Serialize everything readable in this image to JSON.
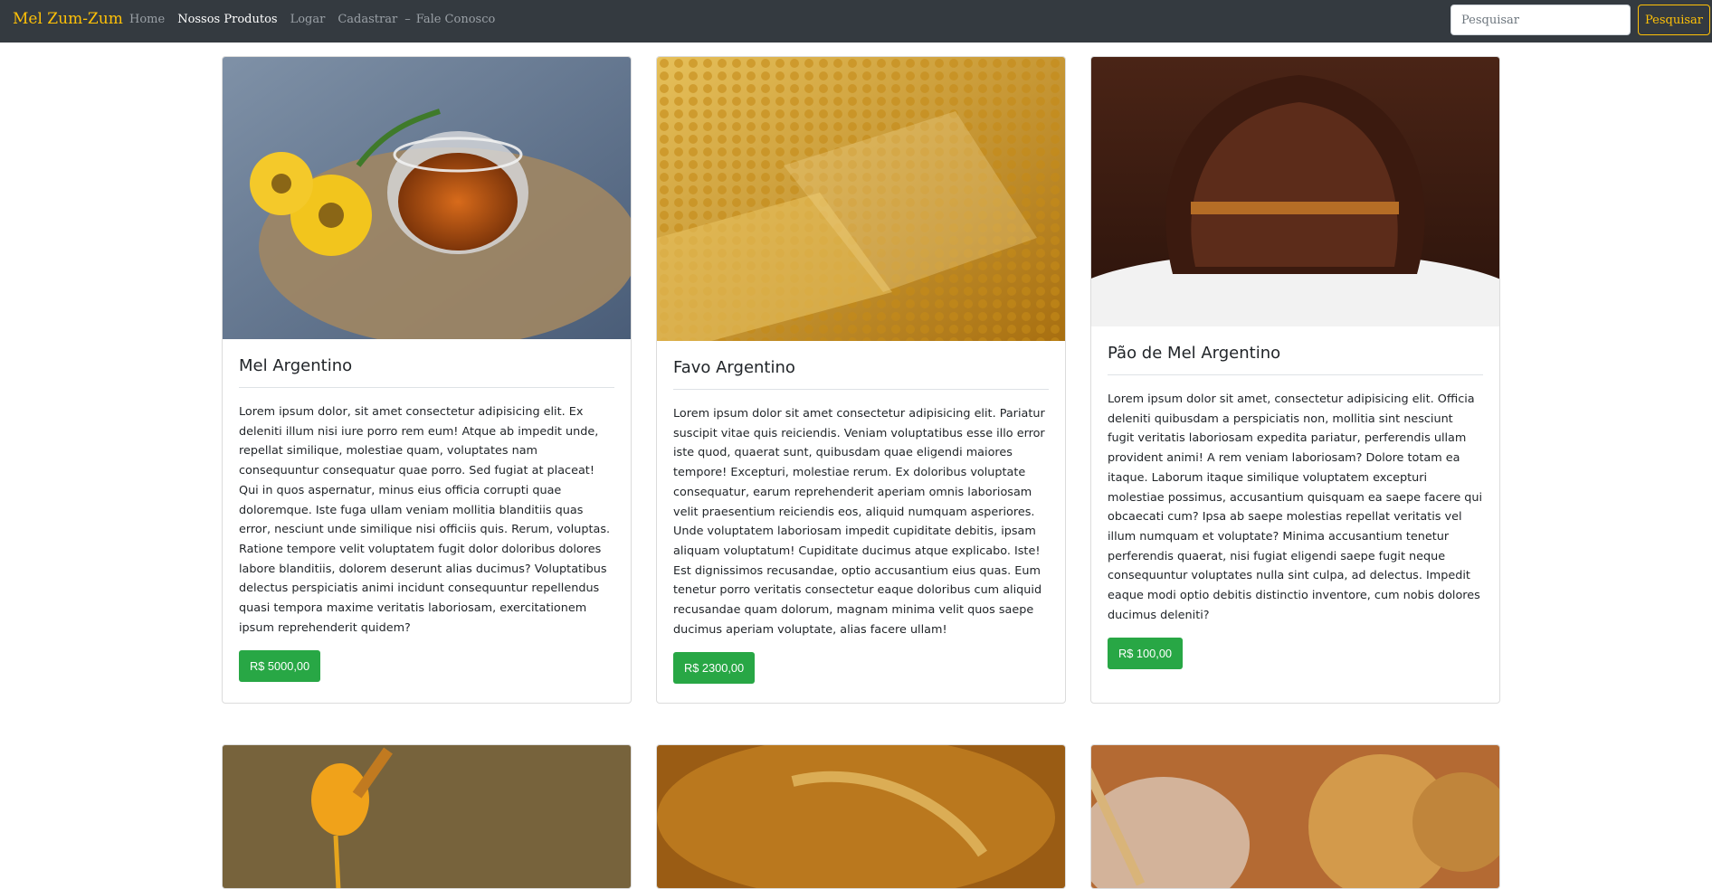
{
  "navbar": {
    "brand": "Mel Zum-Zum",
    "links": [
      {
        "label": "Home"
      },
      {
        "label": "Nossos Produtos"
      },
      {
        "label": "Logar"
      },
      {
        "label": "Cadastrar"
      },
      {
        "label": "Fale Conosco"
      }
    ],
    "separator": "–",
    "search": {
      "placeholder": "Pesquisar",
      "button_label": "Pesquisar"
    }
  },
  "products": [
    {
      "title": "Mel Argentino",
      "description": "Lorem ipsum dolor, sit amet consectetur adipisicing elit. Ex deleniti illum nisi iure porro rem eum! Atque ab impedit unde, repellat similique, molestiae quam, voluptates nam consequuntur consequatur quae porro. Sed fugiat at placeat! Qui in quos aspernatur, minus eius officia corrupti quae doloremque. Iste fuga ullam veniam mollitia blanditiis quas error, nesciunt unde similique nisi officiis quis. Rerum, voluptas. Ratione tempore velit voluptatem fugit dolor doloribus dolores labore blanditiis, dolorem deserunt alias ducimus? Voluptatibus delectus perspiciatis animi incidunt consequuntur repellendus quasi tempora maxime veritatis laboriosam, exercitationem ipsum reprehenderit quidem?",
      "price": "R$ 5000,00"
    },
    {
      "title": "Favo Argentino",
      "description": "Lorem ipsum dolor sit amet consectetur adipisicing elit. Pariatur suscipit vitae quis reiciendis. Veniam voluptatibus esse illo error iste quod, quaerat sunt, quibusdam quae eligendi maiores tempore! Excepturi, molestiae rerum. Ex doloribus voluptate consequatur, earum reprehenderit aperiam omnis laboriosam velit praesentium reiciendis eos, aliquid numquam asperiores. Unde voluptatem laboriosam impedit cupiditate debitis, ipsam aliquam voluptatum! Cupiditate ducimus atque explicabo. Iste! Est dignissimos recusandae, optio accusantium eius quas. Eum tenetur porro veritatis consectetur eaque doloribus cum aliquid recusandae quam dolorum, magnam minima velit quos saepe ducimus aperiam voluptate, alias facere ullam!",
      "price": "R$ 2300,00"
    },
    {
      "title": "Pão de Mel Argentino",
      "description": "Lorem ipsum dolor sit amet, consectetur adipisicing elit. Officia deleniti quibusdam a perspiciatis non, mollitia sint nesciunt fugit veritatis laboriosam expedita pariatur, perferendis ullam provident animi! A rem veniam laboriosam? Dolore totam ea itaque. Laborum itaque similique voluptatem excepturi molestiae possimus, accusantium quisquam ea saepe facere qui obcaecati cum? Ipsa ab saepe molestias repellat veritatis vel illum numquam et voluptate? Minima accusantium tenetur perferendis quaerat, nisi fugiat eligendi saepe fugit neque consequuntur voluptates nulla sint culpa, ad delectus. Impedit eaque modi optio debitis distinctio inventore, cum nobis dolores ducimus deleniti?",
      "price": "R$ 100,00"
    }
  ]
}
